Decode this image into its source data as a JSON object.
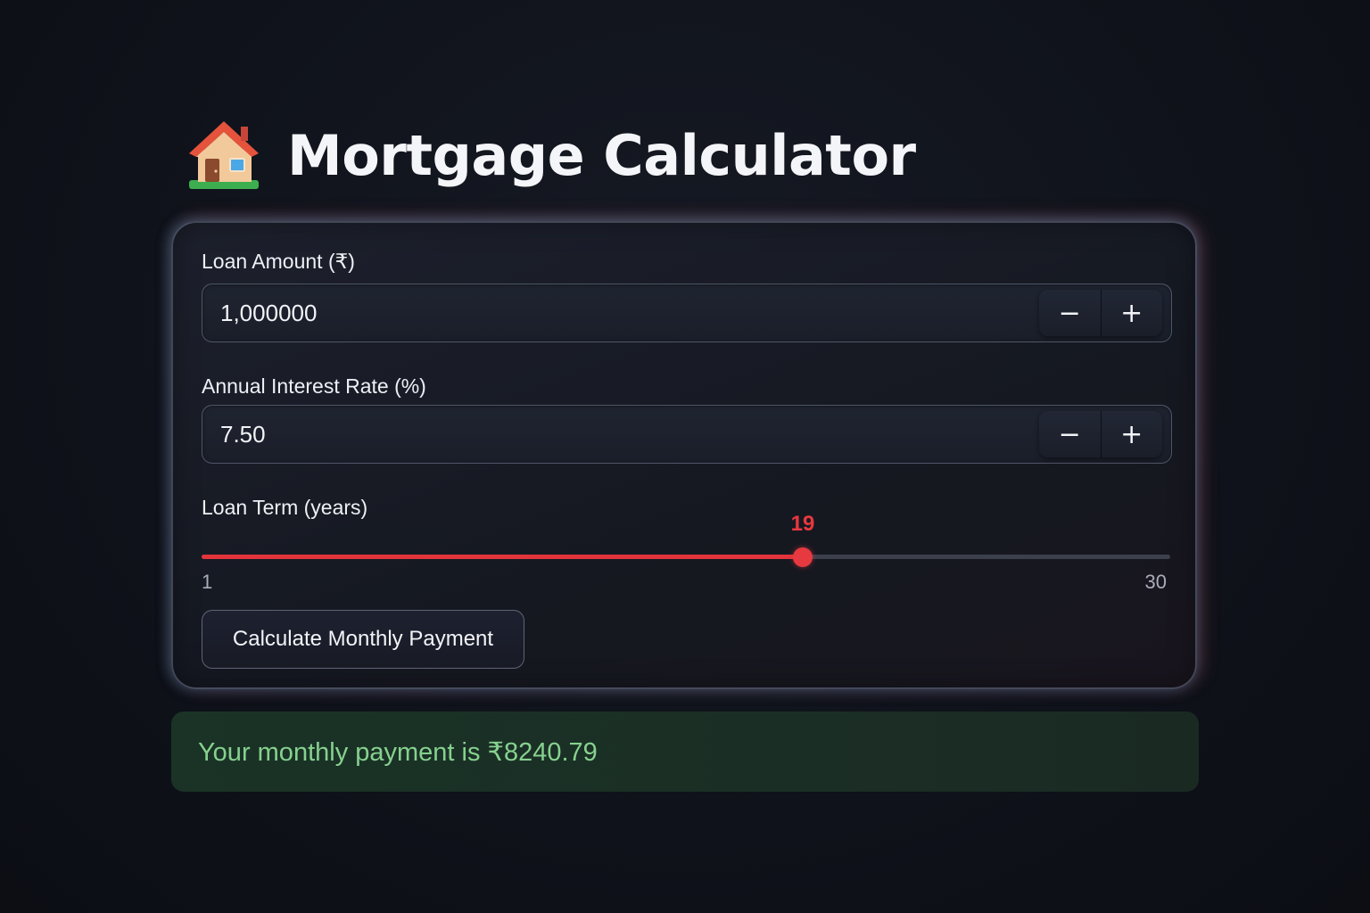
{
  "header": {
    "title": "Mortgage Calculator",
    "icon": "house-icon"
  },
  "loan_amount": {
    "label": "Loan Amount (₹)",
    "value": "1,000000",
    "decrement_label": "−",
    "increment_label": "+"
  },
  "interest_rate": {
    "label": "Annual Interest Rate (%)",
    "value": "7.50",
    "decrement_label": "−",
    "increment_label": "+"
  },
  "loan_term": {
    "label": "Loan Term (years)",
    "value": 19,
    "value_label": "19",
    "min": 1,
    "max": 30,
    "min_label": "1",
    "max_label": "30"
  },
  "calculate_button": {
    "label": "Calculate Monthly Payment"
  },
  "result": {
    "text": "Your monthly payment is ₹8240.79"
  },
  "colors": {
    "accent": "#e3343b",
    "result_text": "#86d18f",
    "result_bg": "#1b2e25",
    "background": "#0f121a"
  }
}
